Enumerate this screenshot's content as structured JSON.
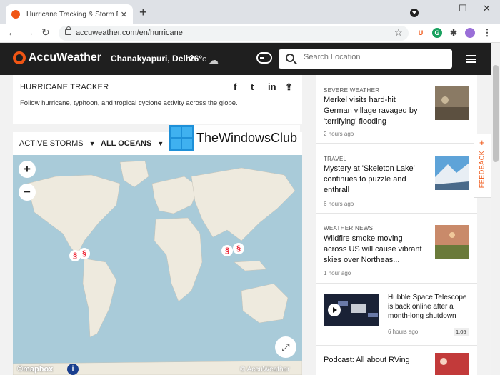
{
  "browser": {
    "tab_title": "Hurricane Tracking & Storm Rada",
    "tab_close": "✕",
    "new_tab": "+",
    "minimize": "—",
    "maximize": "☐",
    "close": "✕",
    "url": "accuweather.com/en/hurricane",
    "back": "←",
    "forward": "→",
    "reload": "↻",
    "bookmark_star": "☆",
    "ext_u": "U",
    "ext_g": "G",
    "ext_puzzle": "✱",
    "kebab": "⋮",
    "colors": {
      "ext_u": "#f05514",
      "ext_g": "#19a15f",
      "avatar": "#9a6fd8"
    }
  },
  "header": {
    "brand": "AccuWeather",
    "location": "Chanakyapuri, Delhi",
    "temperature": "26°",
    "temp_unit": "C",
    "search_placeholder": "Search Location",
    "accent": "#f05514"
  },
  "tracker": {
    "title": "HURRICANE TRACKER",
    "description": "Follow hurricane, typhoon, and tropical cyclone activity across the globe.",
    "share": {
      "facebook": "f",
      "twitter": "t",
      "linkedin": "in",
      "share": "⇪"
    }
  },
  "map": {
    "filter_storms": "ACTIVE STORMS",
    "filter_oceans": "ALL OCEANS",
    "zoom_in": "+",
    "zoom_out": "−",
    "storm_icon": "§",
    "fullscreen": "⤢",
    "attribution_mapbox": "©mapbox",
    "attribution_aw": "© AccuWeather",
    "info": "i",
    "storms": [
      {
        "name": "storm-1"
      },
      {
        "name": "storm-2"
      },
      {
        "name": "storm-3"
      },
      {
        "name": "storm-4"
      }
    ]
  },
  "watermark": {
    "text": "TheWindowsClub"
  },
  "feedback": {
    "plus": "+",
    "label": "FEEDBACK"
  },
  "stories": [
    {
      "category": "SEVERE WEATHER",
      "headline": "Merkel visits hard-hit German village ravaged by 'terrifying' flooding",
      "age": "2 hours ago"
    },
    {
      "category": "TRAVEL",
      "headline": "Mystery at 'Skeleton Lake' continues to puzzle and enthrall",
      "age": "6 hours ago"
    },
    {
      "category": "WEATHER NEWS",
      "headline": "Wildfire smoke moving across US will cause vibrant skies over Northeas...",
      "age": "1 hour ago"
    },
    {
      "category": "",
      "headline": "Hubble Space Telescope is back online after a month-long shutdown",
      "age": "6 hours ago",
      "duration": "1:05"
    },
    {
      "category": "",
      "headline": "Podcast: All about RVing",
      "age": ""
    }
  ]
}
